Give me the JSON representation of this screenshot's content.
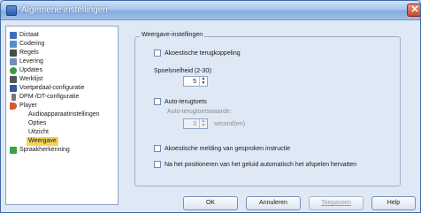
{
  "window": {
    "title": "Algemene instellingen",
    "close_glyph": "✕"
  },
  "tree": {
    "items": [
      {
        "label": "Dictaat",
        "icon": "dictation-icon",
        "color": "#3b6fb8"
      },
      {
        "label": "Codering",
        "icon": "encoding-icon",
        "color": "#5a8bc9"
      },
      {
        "label": "Regels",
        "icon": "rules-icon",
        "color": "#4a4a4a"
      },
      {
        "label": "Levering",
        "icon": "delivery-icon",
        "color": "#6e8fb8"
      },
      {
        "label": "Updates",
        "icon": "updates-icon",
        "color": "#3a9a4a"
      },
      {
        "label": "Werklijst",
        "icon": "worklist-icon",
        "color": "#555555"
      },
      {
        "label": "Voetpedaal-configuratie",
        "icon": "foot-pedal-icon",
        "color": "#2e5c9e"
      },
      {
        "label": "DPM-/DT-configuratie",
        "icon": "device-icon",
        "color": "#777777"
      },
      {
        "label": "Player",
        "icon": "player-icon",
        "color": "#d8582a"
      },
      {
        "label": "Audioapparaatinstellingen",
        "child": true
      },
      {
        "label": "Opties",
        "child": true
      },
      {
        "label": "Uitzicht",
        "child": true
      },
      {
        "label": "Weergave",
        "child": true,
        "selected": true
      },
      {
        "label": "Spraakherkenning",
        "icon": "speech-recognition-icon",
        "color": "#3aa04a"
      }
    ]
  },
  "panel": {
    "group_title": "Weergave-instellingen",
    "acoustic_feedback": {
      "label": "Akoestische terugkoppeling",
      "checked": false
    },
    "speed_label": "Spoelsnelheid (2-30):",
    "speed_value": "5",
    "auto_rewind": {
      "label": "Auto-terugtoets",
      "checked": false
    },
    "auto_rewind_value_label": "Auto-terugtoetswaarde:",
    "auto_rewind_value": "3",
    "auto_rewind_unit": "second(en)",
    "acoustic_speech_notice": {
      "label": "Akoestische melding van gesproken instructie",
      "checked": false
    },
    "auto_play_after_position": {
      "label": "Na het positioneren van het geluid automatisch het afspelen hervatten",
      "checked": false
    }
  },
  "buttons": {
    "ok": "OK",
    "cancel": "Annuleren",
    "apply": "Toepassen",
    "help": "Help"
  },
  "colors": {
    "accent": "#3d6aa8",
    "selection": "#f5d35a"
  }
}
